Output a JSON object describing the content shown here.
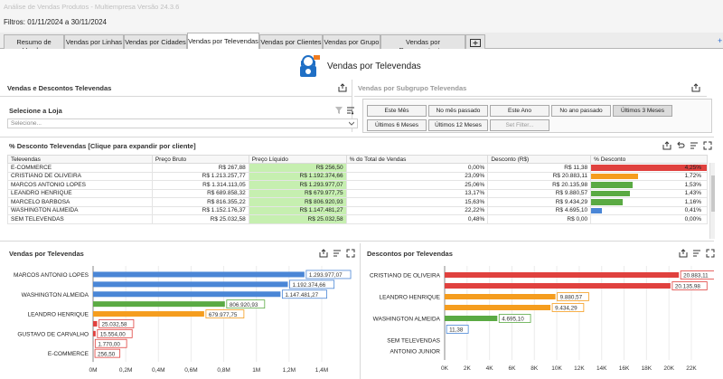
{
  "app_title": "Análise de Vendas Produtos - Multiempresa Versão 24.3.6",
  "filters_text": "Filtros: 01/11/2024 a 30/11/2024",
  "tabs": [
    {
      "label": "Resumo de Vendas"
    },
    {
      "label": "Vendas por Linhas"
    },
    {
      "label": "Vendas por Cidades"
    },
    {
      "label": "Vendas por Televendas"
    },
    {
      "label": "Vendas por Clientes"
    },
    {
      "label": "Vendas por Grupo"
    },
    {
      "label": "Vendas por Representantes"
    }
  ],
  "active_tab": "Vendas por Televendas",
  "page_title": "Vendas por Televendas",
  "left_panel_title": "Vendas e Descontos Televendas",
  "right_panel_title": "Vendas por Subgrupo Televendas",
  "store_label": "Selecione a Loja",
  "store_placeholder": "Selecione...",
  "period_buttons": [
    {
      "label": "Este Mês"
    },
    {
      "label": "No mês passado"
    },
    {
      "label": "Este Ano"
    },
    {
      "label": "No ano passado"
    },
    {
      "label": "Últimos 3 Meses"
    },
    {
      "label": "Últimos 6 Meses"
    },
    {
      "label": "Últimos 12 Meses"
    },
    {
      "label": "Set Filter..."
    }
  ],
  "table_title": "% Desconto Televendas [Clique para expandir por cliente]",
  "table": {
    "headers": [
      "Televendas",
      "Preço Bruto",
      "Preço Líquido",
      "% do Total de Vendas",
      "Desconto (R$)",
      "% Desconto"
    ],
    "rows": [
      {
        "name": "E-COMMERCE",
        "bruto": "R$ 267,88",
        "liquido": "R$ 256,50",
        "pct_total": "0,00%",
        "desconto": "R$ 11,38",
        "pct_desc": "4,25%",
        "pct_value": 4.25,
        "color": "#e0413e"
      },
      {
        "name": "CRISTIANO DE OLIVEIRA",
        "bruto": "R$ 1.213.257,77",
        "liquido": "R$ 1.192.374,66",
        "pct_total": "23,09%",
        "desconto": "R$ 20.883,11",
        "pct_desc": "1,72%",
        "pct_value": 1.72,
        "color": "#f59d1e"
      },
      {
        "name": "MARCOS ANTONIO LOPES",
        "bruto": "R$ 1.314.113,05",
        "liquido": "R$ 1.293.977,07",
        "pct_total": "25,06%",
        "desconto": "R$ 20.135,98",
        "pct_desc": "1,53%",
        "pct_value": 1.53,
        "color": "#5aaa43"
      },
      {
        "name": "LEANDRO HENRIQUE",
        "bruto": "R$ 689.858,32",
        "liquido": "R$ 679.977,75",
        "pct_total": "13,17%",
        "desconto": "R$ 9.880,57",
        "pct_desc": "1,43%",
        "pct_value": 1.43,
        "color": "#5aaa43"
      },
      {
        "name": "MARCELO BARBOSA",
        "bruto": "R$ 816.355,22",
        "liquido": "R$ 806.920,93",
        "pct_total": "15,63%",
        "desconto": "R$ 9.434,29",
        "pct_desc": "1,16%",
        "pct_value": 1.16,
        "color": "#5aaa43"
      },
      {
        "name": "WASHINGTON ALMEIDA",
        "bruto": "R$ 1.152.176,37",
        "liquido": "R$ 1.147.481,27",
        "pct_total": "22,22%",
        "desconto": "R$ 4.695,10",
        "pct_desc": "0,41%",
        "pct_value": 0.41,
        "color": "#4a86d6"
      },
      {
        "name": "SEM TELEVENDAS",
        "bruto": "R$ 25.032,58",
        "liquido": "R$ 25.032,58",
        "pct_total": "0,48%",
        "desconto": "R$ 0,00",
        "pct_desc": "0,00%",
        "pct_value": 0.0,
        "color": "#4a86d6"
      }
    ]
  },
  "chart_data": [
    {
      "type": "bar",
      "orientation": "horizontal",
      "title": "Vendas por Televendas",
      "categories": [
        "MARCOS ANTONIO LOPES",
        "",
        "WASHINGTON ALMEIDA",
        "",
        "LEANDRO HENRIQUE",
        "",
        "GUSTAVO DE CARVALHO",
        "",
        "E-COMMERCE"
      ],
      "values": [
        1293977.07,
        1192374.66,
        1147481.27,
        806920.93,
        679977.75,
        25032.58,
        15554.0,
        1770.0,
        256.5
      ],
      "labels": [
        "1.293.977,07",
        "1.192.374,66",
        "1.147.481,27",
        "806.920,93",
        "679.977,75",
        "25.032,58",
        "15.554,00",
        "1.770,00",
        "256,50"
      ],
      "colors": [
        "#4a86d6",
        "#4a86d6",
        "#4a86d6",
        "#5aaa43",
        "#f59d1e",
        "#e0413e",
        "#e0413e",
        "#e0413e",
        "#e0413e"
      ],
      "xlim": [
        0,
        1400000
      ],
      "ticks": [
        "0M",
        "0,2M",
        "0,4M",
        "0,6M",
        "0,8M",
        "1M",
        "1,2M",
        "1,4M"
      ]
    },
    {
      "type": "bar",
      "orientation": "horizontal",
      "title": "Descontos por Televendas",
      "categories": [
        "CRISTIANO DE OLIVEIRA",
        "",
        "LEANDRO HENRIQUE",
        "",
        "WASHINGTON ALMEIDA",
        "",
        "SEM TELEVENDAS",
        "ANTONIO JUNIOR"
      ],
      "values": [
        20883.11,
        20135.98,
        9880.57,
        9434.29,
        4695.1,
        11.38,
        0,
        0
      ],
      "labels": [
        "20.883,11",
        "20.135,98",
        "9.880,57",
        "9.434,29",
        "4.695,10",
        "11,38",
        "",
        ""
      ],
      "colors": [
        "#e0413e",
        "#e0413e",
        "#f59d1e",
        "#f59d1e",
        "#5aaa43",
        "#4a86d6",
        "#4a86d6",
        "#4a86d6"
      ],
      "xlim": [
        0,
        22000
      ],
      "ticks": [
        "0K",
        "2K",
        "4K",
        "6K",
        "8K",
        "10K",
        "12K",
        "14K",
        "16K",
        "18K",
        "20K",
        "22K"
      ]
    }
  ]
}
